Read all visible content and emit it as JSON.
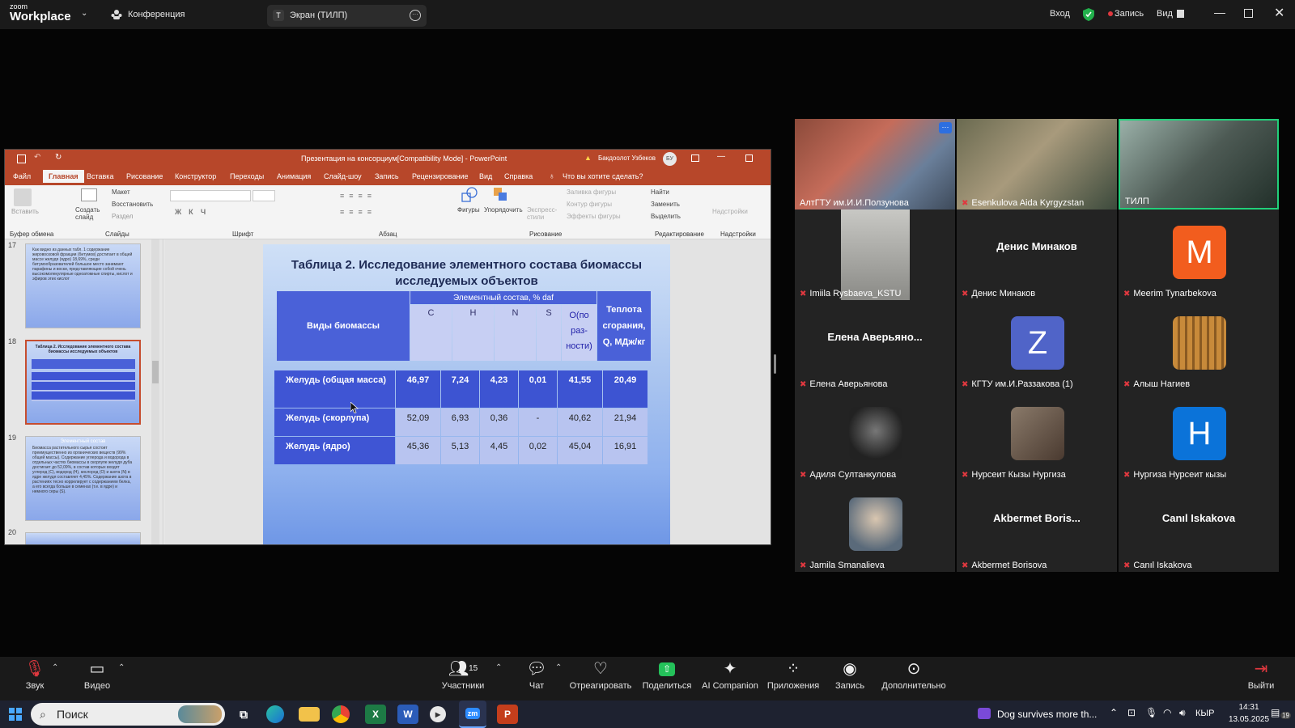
{
  "zoom": {
    "brand_line1": "zoom",
    "brand_line2": "Workplace",
    "meeting_label": "Конференция",
    "share_initial": "T",
    "share_label": "Экран (ТИЛП)",
    "signin": "Вход",
    "record_label": "Запись",
    "view_label": "Вид"
  },
  "ppt": {
    "title": "Презентация на консорциум[Compatibility Mode] - PowerPoint",
    "user": "Бакдоолот Узбеков",
    "user_initials": "БУ",
    "tabs": [
      "Файл",
      "Главная",
      "Вставка",
      "Рисование",
      "Конструктор",
      "Переходы",
      "Анимация",
      "Слайд-шоу",
      "Запись",
      "Рецензирование",
      "Вид",
      "Справка",
      "Что вы хотите сделать?"
    ],
    "ribbon": {
      "paste": "Вставить",
      "create_slide": "Создать слайд",
      "layout": "Макет",
      "reset": "Восстановить",
      "section": "Раздел",
      "shapes": "Фигуры",
      "arrange": "Упорядочить",
      "quick_styles": "Экспресс-стили",
      "fill": "Заливка фигуры",
      "outline": "Контур фигуры",
      "effects": "Эффекты фигуры",
      "find": "Найти",
      "replace": "Заменить",
      "select": "Выделить",
      "addins": "Надстройки",
      "groups": [
        "Буфер обмена",
        "Слайды",
        "Шрифт",
        "Абзац",
        "Рисование",
        "Редактирование",
        "Надстройки"
      ]
    },
    "slide_numbers": [
      "17",
      "18",
      "19",
      "20"
    ],
    "thumb17_text": "Как видно из данных табл. 1 содержание жировосковой фракции (битумов) достигает в общей массе желудя (ядро) 18,69%, среди битумообразователей большое место занимают парафины и воски, представляющие собой очень высокомолекулярные одноатомные спирты, кислот и эфиров этих кислот",
    "thumb18_text": "Таблица 2. Исследование элементного состава биомассы исследуемых объектов",
    "thumb19_title": "Элементный состав",
    "thumb19_text": "Биомасса растительного сырья состоит преимущественно из органических веществ (99% общей массы). Содержание углерода и водорода в отдельных частях биомассы в скорлупе желудя дуба достигает до 52,09%, в состав которых входят углерод (С), водород (Н), кислород (О) и азота (N) в ядре желудя составляет 4,45%. Содержание азота в растениях тесно коррелирует с содержанием белка, а его всегда больше в семенах (т.е. в ядре) и немного серы (S)."
  },
  "slide": {
    "title": "Таблица 2. Исследование элементного состава биомассы исследуемых объектов",
    "col_group": "Элементный состав, % daf",
    "col_kinds": "Виды биомассы",
    "col_heat": "Теплота сгорания, Q, МДж/кг",
    "cols": [
      "C",
      "H",
      "N",
      "S",
      "O(по раз-ности)"
    ],
    "rows": [
      {
        "label": "Желудь (общая масса)",
        "values": [
          "46,97",
          "7,24",
          "4,23",
          "0,01",
          "41,55",
          "20,49"
        ]
      },
      {
        "label": "Желудь (скорлупа)",
        "values": [
          "52,09",
          "6,93",
          "0,36",
          "-",
          "40,62",
          "21,94"
        ]
      },
      {
        "label": "Желудь (ядро)",
        "values": [
          "45,36",
          "5,13",
          "4,45",
          "0,02",
          "45,04",
          "16,91"
        ]
      }
    ]
  },
  "participants": [
    {
      "name": "АлтГТУ им.И.И.Ползунова",
      "type": "video"
    },
    {
      "name": "Esenkulova Aida Kyrgyzstan",
      "type": "video"
    },
    {
      "name": "ТИЛП",
      "type": "video"
    },
    {
      "name": "Imiila Rysbaeva_KSTU",
      "type": "photo"
    },
    {
      "name": "Денис Минаков",
      "display": "Денис Минаков",
      "type": "name"
    },
    {
      "name": "Meerim Tynarbekova",
      "letter": "M",
      "color": "#f25d1e",
      "type": "letter"
    },
    {
      "name": "Елена Аверьянова",
      "display": "Елена Аверьяно...",
      "type": "name"
    },
    {
      "name": "КГТУ им.И.Раззакова (1)",
      "letter": "Z",
      "color": "#5064c8",
      "type": "letter"
    },
    {
      "name": "Алыш Нагиев",
      "type": "photo"
    },
    {
      "name": "Адиля Султанкулова",
      "type": "photo"
    },
    {
      "name": "Нурсеит Кызы Нургиза",
      "type": "photo"
    },
    {
      "name": "Нургиза Нурсеит кызы",
      "letter": "H",
      "color": "#0b73d9",
      "type": "letter"
    },
    {
      "name": "Jamila Smanalieva",
      "type": "photo"
    },
    {
      "name": "Akbermet Borisova",
      "display": "Akbermet Boris...",
      "type": "name"
    },
    {
      "name": "Canıl Iskakova",
      "display": "Canıl Iskakova",
      "type": "name"
    }
  ],
  "toolbar": {
    "audio": "Звук",
    "video": "Видео",
    "participants": "Участники",
    "participants_count": "15",
    "chat": "Чат",
    "react": "Отреагировать",
    "share": "Поделиться",
    "ai": "AI Companion",
    "apps": "Приложения",
    "record": "Запись",
    "more": "Дополнительно",
    "leave": "Выйти"
  },
  "taskbar": {
    "search": "Поиск",
    "news": "Dog survives more th...",
    "lang": "КЫР",
    "time": "14:31",
    "date": "13.05.2025",
    "notif": "19"
  }
}
